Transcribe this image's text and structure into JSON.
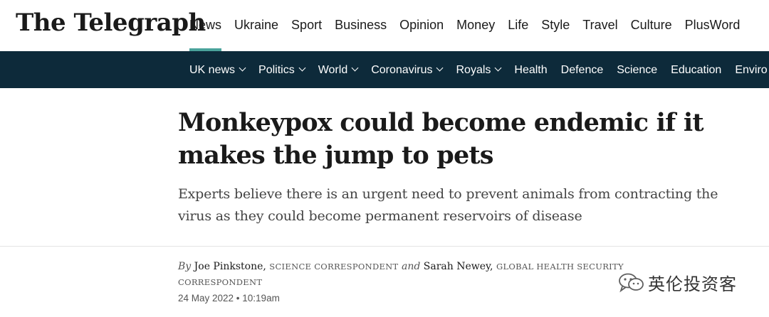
{
  "header": {
    "logo_text": "The Telegraph",
    "primary_nav": [
      "News",
      "Ukraine",
      "Sport",
      "Business",
      "Opinion",
      "Money",
      "Life",
      "Style",
      "Travel",
      "Culture",
      "PlusWord"
    ],
    "active_nav": "News",
    "accent_color": "#4aa39b"
  },
  "sub_nav": {
    "background": "#0d2a3a",
    "items": [
      {
        "label": "UK news",
        "has_dropdown": true
      },
      {
        "label": "Politics",
        "has_dropdown": true
      },
      {
        "label": "World",
        "has_dropdown": true
      },
      {
        "label": "Coronavirus",
        "has_dropdown": true
      },
      {
        "label": "Royals",
        "has_dropdown": true
      },
      {
        "label": "Health",
        "has_dropdown": false
      },
      {
        "label": "Defence",
        "has_dropdown": false
      },
      {
        "label": "Science",
        "has_dropdown": false
      },
      {
        "label": "Education",
        "has_dropdown": false
      },
      {
        "label": "Enviro",
        "has_dropdown": false
      }
    ]
  },
  "article": {
    "headline": "Monkeypox could become endemic if it makes the jump to pets",
    "standfirst": "Experts believe there is an urgent need to prevent animals from contracting the virus as they could become permanent reservoirs of disease",
    "byline": {
      "by": "By",
      "author1": "Joe Pinkstone,",
      "role1": "SCIENCE CORRESPONDENT",
      "and": "and",
      "author2": "Sarah Newey,",
      "role2": "GLOBAL HEALTH SECURITY CORRESPONDENT"
    },
    "date": "24 May 2022 • 10:19am"
  },
  "watermark": {
    "icon": "wechat-icon",
    "text": "英伦投资客"
  }
}
